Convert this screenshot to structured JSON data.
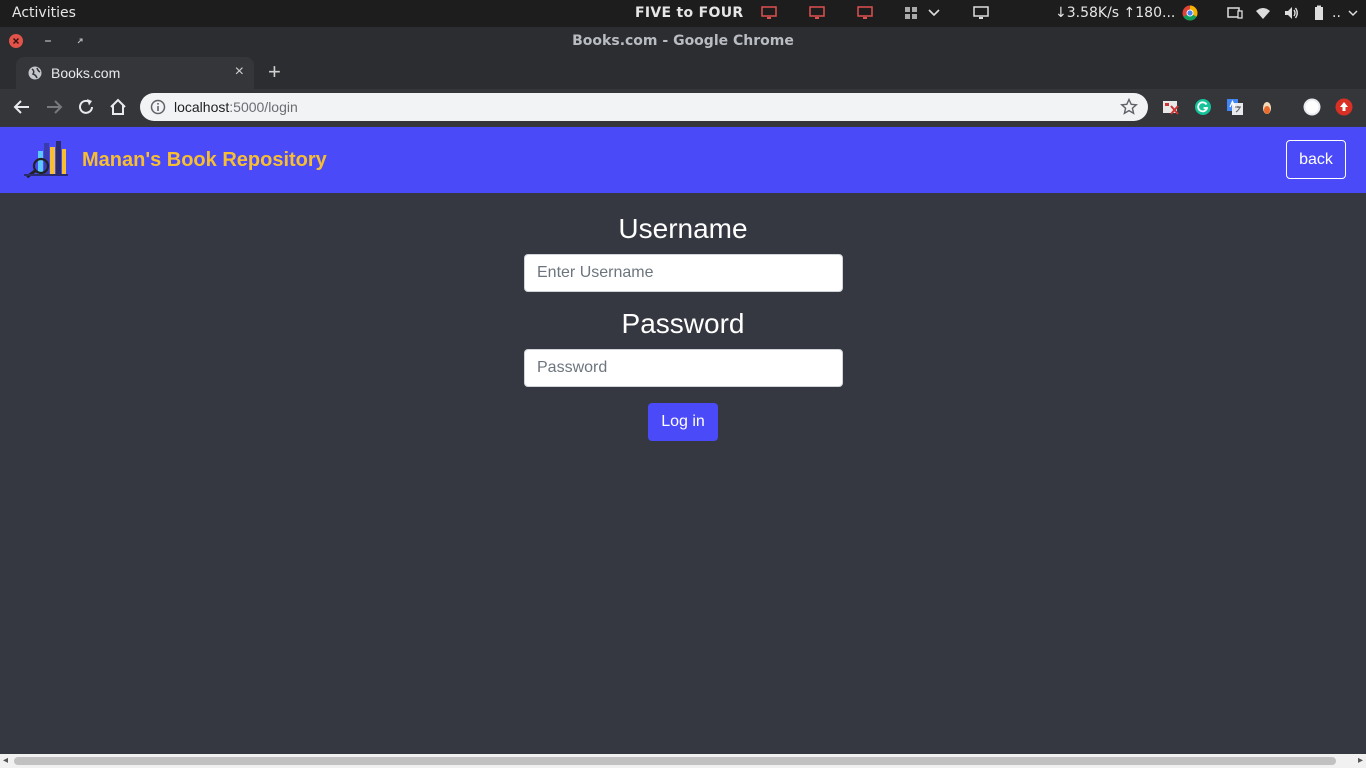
{
  "os_bar": {
    "activities": "Activities",
    "center_title": "FIVE to FOUR",
    "netspeed": "↓3.58K/s ↑180...",
    "overflow": ".."
  },
  "window": {
    "title": "Books.com - Google Chrome"
  },
  "tab": {
    "title": "Books.com",
    "close": "×",
    "new_tab": "+"
  },
  "address_bar": {
    "host": "localhost",
    "path": ":5000/login"
  },
  "site": {
    "brand": "Manan's Book Repository",
    "back_label": "back"
  },
  "login": {
    "username_label": "Username",
    "username_placeholder": "Enter Username",
    "password_label": "Password",
    "password_placeholder": "Password",
    "submit_label": "Log in"
  },
  "colors": {
    "header_bg": "#4a4af8",
    "brand_text": "#f7be31",
    "page_bg": "#353840",
    "button_bg": "#4a4af8"
  }
}
